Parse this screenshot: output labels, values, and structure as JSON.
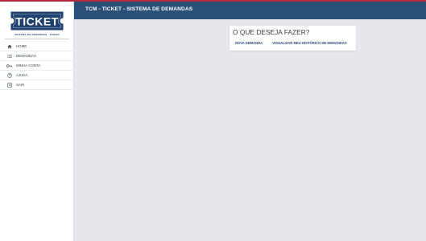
{
  "brand": {
    "logo_text": "TICKET",
    "subtitle": "SISTEMA DE DEMANDAS - TCMGO"
  },
  "colors": {
    "header_bg": "#2b5078",
    "accent_line": "#b5273a",
    "page_bg": "#e8e8ec",
    "link": "#2b4a78"
  },
  "header": {
    "title": "TCM - TICKET - SISTEMA DE DEMANDAS"
  },
  "sidebar": {
    "items": [
      {
        "label": "HOME",
        "icon": "home-icon"
      },
      {
        "label": "DEMANDAS",
        "icon": "list-icon"
      },
      {
        "label": "MINHA CONTA",
        "icon": "key-icon"
      },
      {
        "label": "AJUDA",
        "icon": "help-icon"
      },
      {
        "label": "SAIR",
        "icon": "logout-icon"
      }
    ]
  },
  "card": {
    "title": "O QUE DESEJA FAZER?",
    "actions": [
      {
        "label": "NOVA DEMANDA"
      },
      {
        "label": "VISUALIZAR MEU HISTÓRICO DE DEMANDAS"
      }
    ]
  }
}
